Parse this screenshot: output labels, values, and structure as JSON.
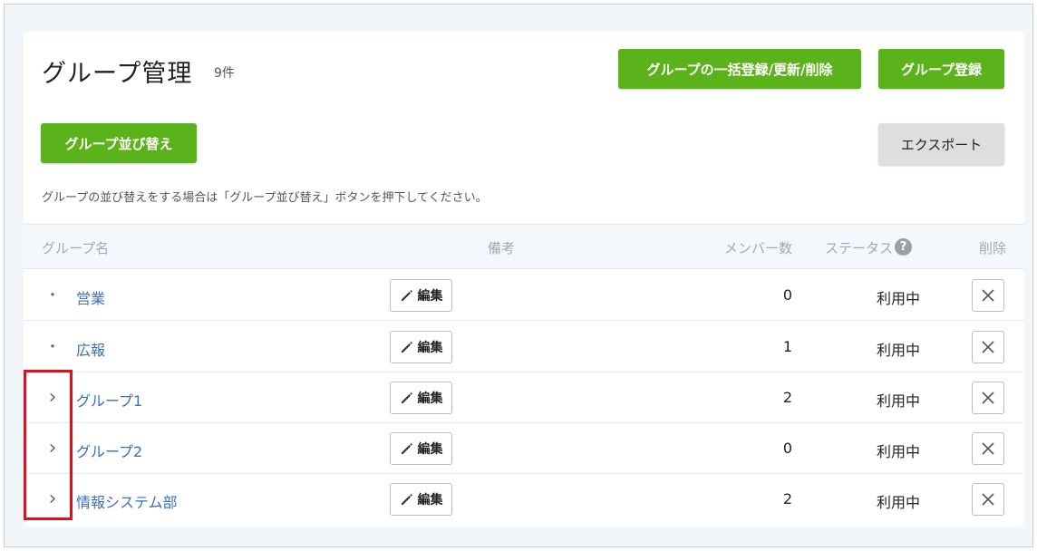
{
  "header": {
    "title": "グループ管理",
    "count": "9件",
    "bulk_button": "グループの一括登録/更新/削除",
    "register_button": "グループ登録",
    "sort_button": "グループ並び替え",
    "export_button": "エクスポート",
    "hint": "グループの並び替えをする場合は「グループ並び替え」ボタンを押下してください。"
  },
  "table": {
    "columns": {
      "name": "グループ名",
      "note": "備考",
      "members": "メンバー数",
      "status": "ステータス",
      "help": "?",
      "delete": "削除"
    },
    "edit_label": "編集",
    "rows": [
      {
        "marker": "・",
        "name": "営業",
        "members": "0",
        "status": "利用中"
      },
      {
        "marker": "・",
        "name": "広報",
        "members": "1",
        "status": "利用中"
      },
      {
        "marker": "›",
        "name": "グループ1",
        "members": "2",
        "status": "利用中"
      },
      {
        "marker": "›",
        "name": "グループ2",
        "members": "0",
        "status": "利用中"
      },
      {
        "marker": "›",
        "name": "情報システム部",
        "members": "2",
        "status": "利用中"
      }
    ]
  },
  "colors": {
    "accent_green": "#5cb21a",
    "link_blue": "#3a6fbd",
    "highlight_red": "#e0101a"
  }
}
